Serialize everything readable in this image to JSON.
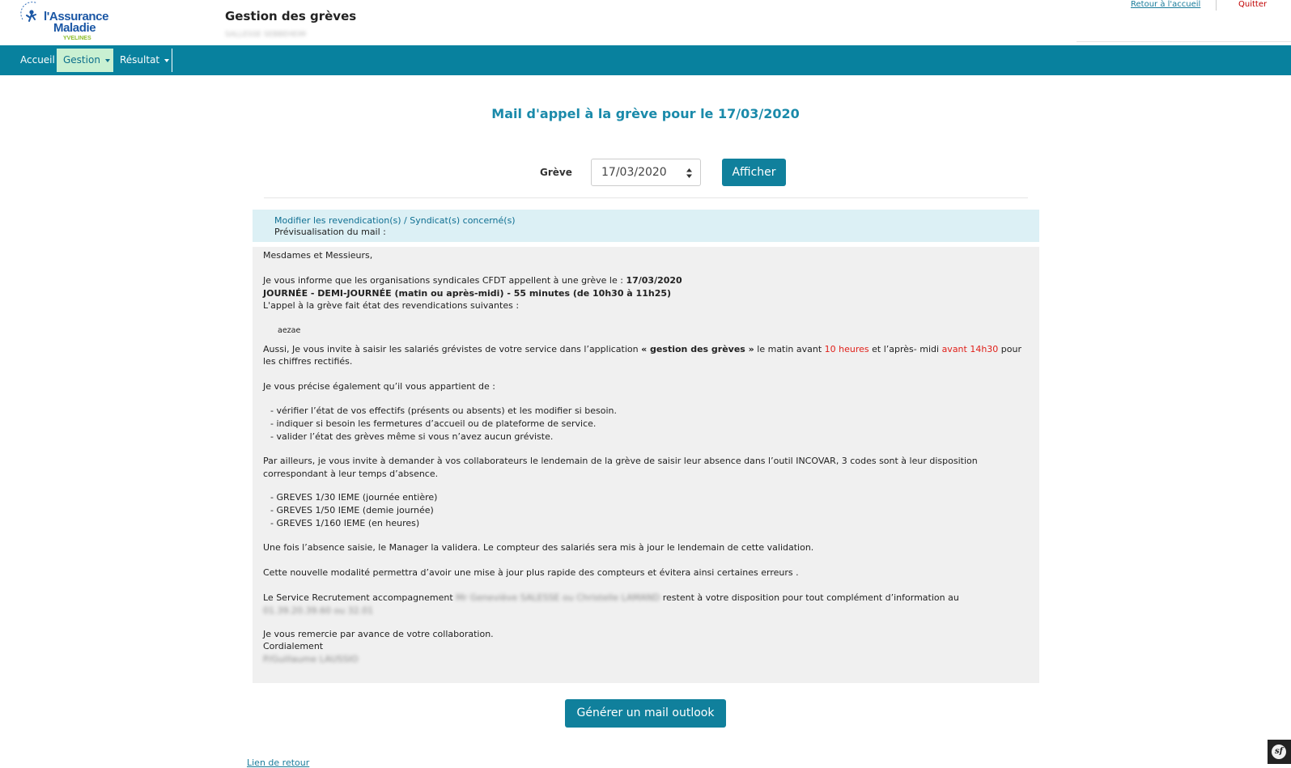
{
  "header": {
    "logo_line1": "l'Assurance",
    "logo_line2": "Maladie",
    "logo_line3": "YVELINES",
    "app_title": "Gestion des grèves",
    "app_subtitle": "SALLESSE SEBBEHEIM",
    "back_home": "Retour à l'accueil",
    "quit": "Quitter"
  },
  "nav": {
    "home": "Accueil",
    "gestion": "Gestion",
    "resultat": "Résultat"
  },
  "page": {
    "heading": "Mail d'appel à la grève pour le 17/03/2020",
    "form_label": "Grève",
    "selected_date": "17/03/2020",
    "show_button": "Afficher"
  },
  "preview": {
    "modify_link": "Modifier les revendication(s) / Syndicat(s) concerné(s)",
    "preview_label": "Prévisualisation du mail :",
    "greeting": "Mesdames et Messieurs,",
    "intro_text": "Je vous informe que les organisations syndicales CFDT appellent à une grève le : ",
    "intro_date": "17/03/2020",
    "strike_type": "JOURNÉE - DEMI-JOURNÉE (matin ou après-midi) - 55 minutes (de 10h30 à 11h25)",
    "claims_intro": "L'appel à la grève fait état des revendications suivantes :",
    "claim": "aezae",
    "invite_1": "Aussi, Je vous invite à saisir les salariés grévistes de votre service dans l’application ",
    "invite_app": "« gestion des grèves »",
    "invite_2": " le matin avant ",
    "invite_morning": "10 heures",
    "invite_3": " et l’après- midi ",
    "invite_afternoon": "avant 14h30",
    "invite_4": " pour",
    "invite_5": "les chiffres rectifiés.",
    "duty_intro": "Je vous précise également qu’il vous appartient de :",
    "duty_1": "- vérifier l’état de vos effectifs (présents ou absents) et les modifier si besoin.",
    "duty_2": "- indiquer si besoin les fermetures d’accueil ou de plateforme de service.",
    "duty_3": "- valider l’état des grèves même si vous n’avez aucun gréviste.",
    "codes_1": "Par ailleurs, je vous invite à demander à vos collaborateurs le lendemain de la grève de saisir leur absence dans l’outil INCOVAR, 3 codes sont à leur disposition",
    "codes_2": "correspondant à leur temps d’absence.",
    "code_1": "- GREVES 1/30 IEME (journée entière)",
    "code_2": "- GREVES 1/50 IEME (demie journée)",
    "code_3": "- GREVES 1/160 IEME (en heures)",
    "validation": "Une fois l’absence saisie, le Manager la validera. Le compteur des salariés sera mis à jour le lendemain de cette validation.",
    "modality": "Cette nouvelle modalité permettra d’avoir une mise à jour plus rapide des compteurs et évitera ainsi certaines erreurs .",
    "contact_1": "Le Service Recrutement accompagnement ",
    "contact_names": "Mr Geneviève SALESSE ou Christelle LAMAND",
    "contact_2": " restent à votre disposition pour tout complément d’information au",
    "contact_phone": "01.39.20.39.60 ou 32.01",
    "thanks": "Je vous remercie par avance de votre collaboration.",
    "closing": "Cordialement",
    "signature": "P/Guillaume LAUSSIO"
  },
  "generate_button": "Générer un mail outlook",
  "footer_link": "Lien de retour",
  "colors": {
    "navbar": "#08819e",
    "nav_active_bg": "#c9f0d2",
    "primary_button": "#10809c",
    "heading": "#1a8aaa",
    "info_bar": "#dcf0f5",
    "mail_bg": "#f0f0f0",
    "highlight_red": "#e0201a"
  }
}
